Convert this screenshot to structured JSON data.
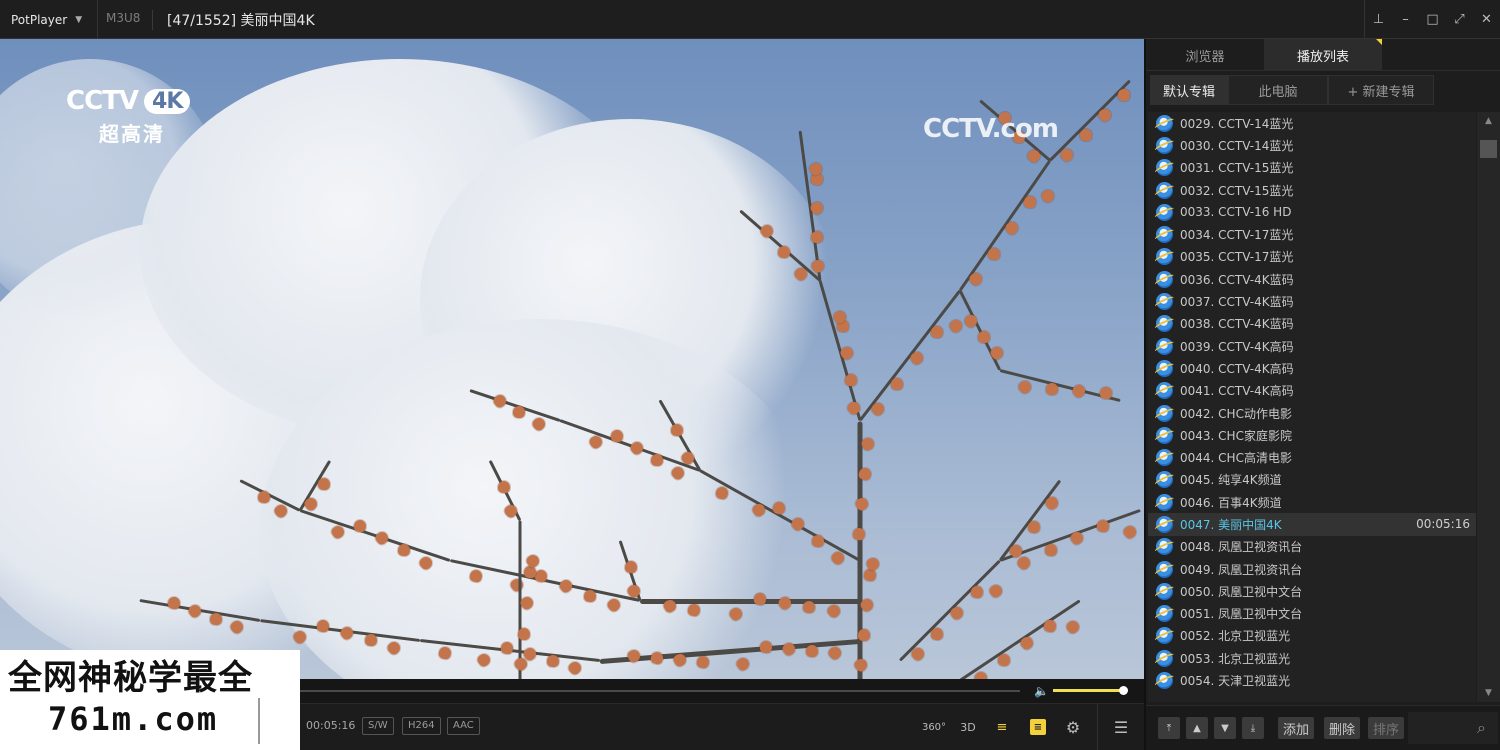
{
  "app": {
    "name": "PotPlayer",
    "format": "M3U8",
    "title": "[47/1552] 美丽中国4K"
  },
  "window_buttons": [
    "pin-icon",
    "minimize-icon",
    "maximize-icon",
    "fullscreen-icon",
    "close-icon"
  ],
  "video": {
    "logo_left_line1": "CCTV",
    "logo_left_4k": "4K",
    "logo_left_line2": "超高清",
    "logo_right": "CCTV.com"
  },
  "player": {
    "time": "00:05:16",
    "tags": [
      "S/W",
      "H264",
      "AAC"
    ],
    "icon_360": "360°",
    "icon_3d": "3D",
    "volume": 0.95
  },
  "watermark": {
    "line1": "全网神秘学最全",
    "line2": "761m.com"
  },
  "panel": {
    "tabs": [
      "浏览器",
      "播放列表"
    ],
    "subtabs": [
      "默认专辑",
      "此电脑",
      "+ 新建专辑"
    ],
    "current_duration": "00:05:16",
    "items": [
      "0029. CCTV-14蓝光",
      "0030. CCTV-14蓝光",
      "0031. CCTV-15蓝光",
      "0032. CCTV-15蓝光",
      "0033. CCTV-16 HD",
      "0034. CCTV-17蓝光",
      "0035. CCTV-17蓝光",
      "0036. CCTV-4K蓝码",
      "0037. CCTV-4K蓝码",
      "0038. CCTV-4K蓝码",
      "0039. CCTV-4K高码",
      "0040. CCTV-4K高码",
      "0041. CCTV-4K高码",
      "0042. CHC动作电影",
      "0043. CHC家庭影院",
      "0044. CHC高清电影",
      "0045. 纯享4K频道",
      "0046. 百事4K频道",
      "0047. 美丽中国4K",
      "0048. 凤凰卫视资讯台",
      "0049. 凤凰卫视资讯台",
      "0050. 凤凰卫视中文台",
      "0051. 凤凰卫视中文台",
      "0052. 北京卫视蓝光",
      "0053. 北京卫视蓝光",
      "0054. 天津卫视蓝光"
    ],
    "bottom_buttons": [
      "添加",
      "删除",
      "排序"
    ]
  }
}
